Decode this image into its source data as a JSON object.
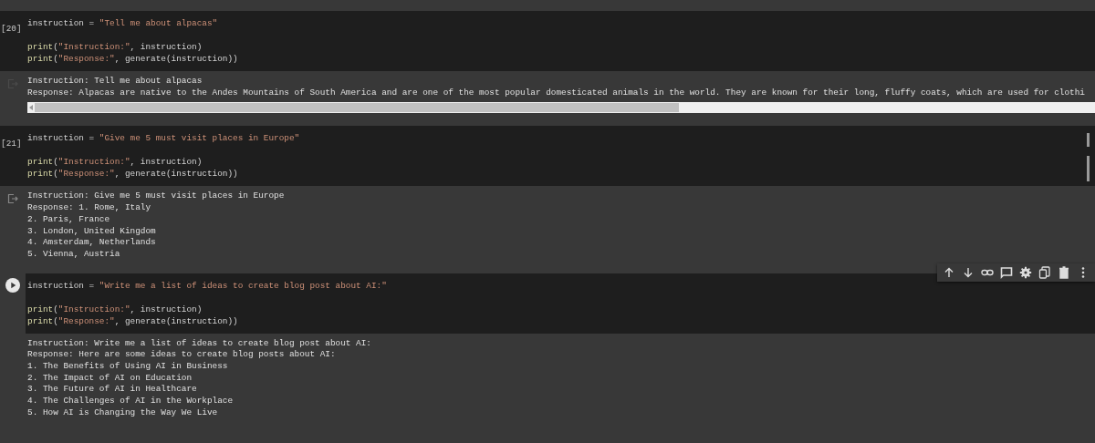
{
  "cells": [
    {
      "execution_count": "[20]",
      "focused": false,
      "code": [
        [
          {
            "kind": "plain",
            "t": "instruction = "
          },
          {
            "kind": "string",
            "t": "\"Tell me about alpacas\""
          }
        ],
        [
          {
            "kind": "func",
            "t": "print"
          },
          {
            "kind": "plain",
            "t": "("
          },
          {
            "kind": "string",
            "t": "\"Instruction:\""
          },
          {
            "kind": "plain",
            "t": ", instruction)"
          }
        ],
        [
          {
            "kind": "func",
            "t": "print"
          },
          {
            "kind": "plain",
            "t": "("
          },
          {
            "kind": "string",
            "t": "\"Response:\""
          },
          {
            "kind": "plain",
            "t": ", generate(instruction))"
          }
        ]
      ],
      "output": [
        "Instruction: Tell me about alpacas",
        "Response: Alpacas are native to the Andes Mountains of South America and are one of the most popular domesticated animals in the world. They are known for their long, fluffy coats, which are used for clothi"
      ],
      "scrollable": true
    },
    {
      "execution_count": "[21]",
      "focused": false,
      "code": [
        [
          {
            "kind": "plain",
            "t": "instruction = "
          },
          {
            "kind": "string",
            "t": "\"Give me 5 must visit places in Europe\""
          }
        ],
        [
          {
            "kind": "func",
            "t": "print"
          },
          {
            "kind": "plain",
            "t": "("
          },
          {
            "kind": "string",
            "t": "\"Instruction:\""
          },
          {
            "kind": "plain",
            "t": ", instruction)"
          }
        ],
        [
          {
            "kind": "func",
            "t": "print"
          },
          {
            "kind": "plain",
            "t": "("
          },
          {
            "kind": "string",
            "t": "\"Response:\""
          },
          {
            "kind": "plain",
            "t": ", generate(instruction))"
          }
        ]
      ],
      "output": [
        "Instruction: Give me 5 must visit places in Europe",
        "Response: 1. Rome, Italy",
        "2. Paris, France",
        "3. London, United Kingdom",
        "4. Amsterdam, Netherlands",
        "5. Vienna, Austria"
      ],
      "scrollable": false
    },
    {
      "focused": true,
      "code": [
        [
          {
            "kind": "plain",
            "t": "instruction = "
          },
          {
            "kind": "string",
            "t": "\"Write me a list of ideas to create blog post about AI:\""
          }
        ],
        [
          {
            "kind": "func",
            "t": "print"
          },
          {
            "kind": "plain",
            "t": "("
          },
          {
            "kind": "string",
            "t": "\"Instruction:\""
          },
          {
            "kind": "plain",
            "t": ", instruction)"
          }
        ],
        [
          {
            "kind": "func",
            "t": "print"
          },
          {
            "kind": "plain",
            "t": "("
          },
          {
            "kind": "string",
            "t": "\"Response:\""
          },
          {
            "kind": "plain",
            "t": ", generate(instruction))"
          }
        ]
      ],
      "output": [
        "Instruction: Write me a list of ideas to create blog post about AI:",
        "Response: Here are some ideas to create blog posts about AI:",
        "1. The Benefits of Using AI in Business",
        "2. The Impact of AI on Education",
        "3. The Future of AI in Healthcare",
        "4. The Challenges of AI in the Workplace",
        "5. How AI is Changing the Way We Live"
      ],
      "scrollable": false
    }
  ]
}
